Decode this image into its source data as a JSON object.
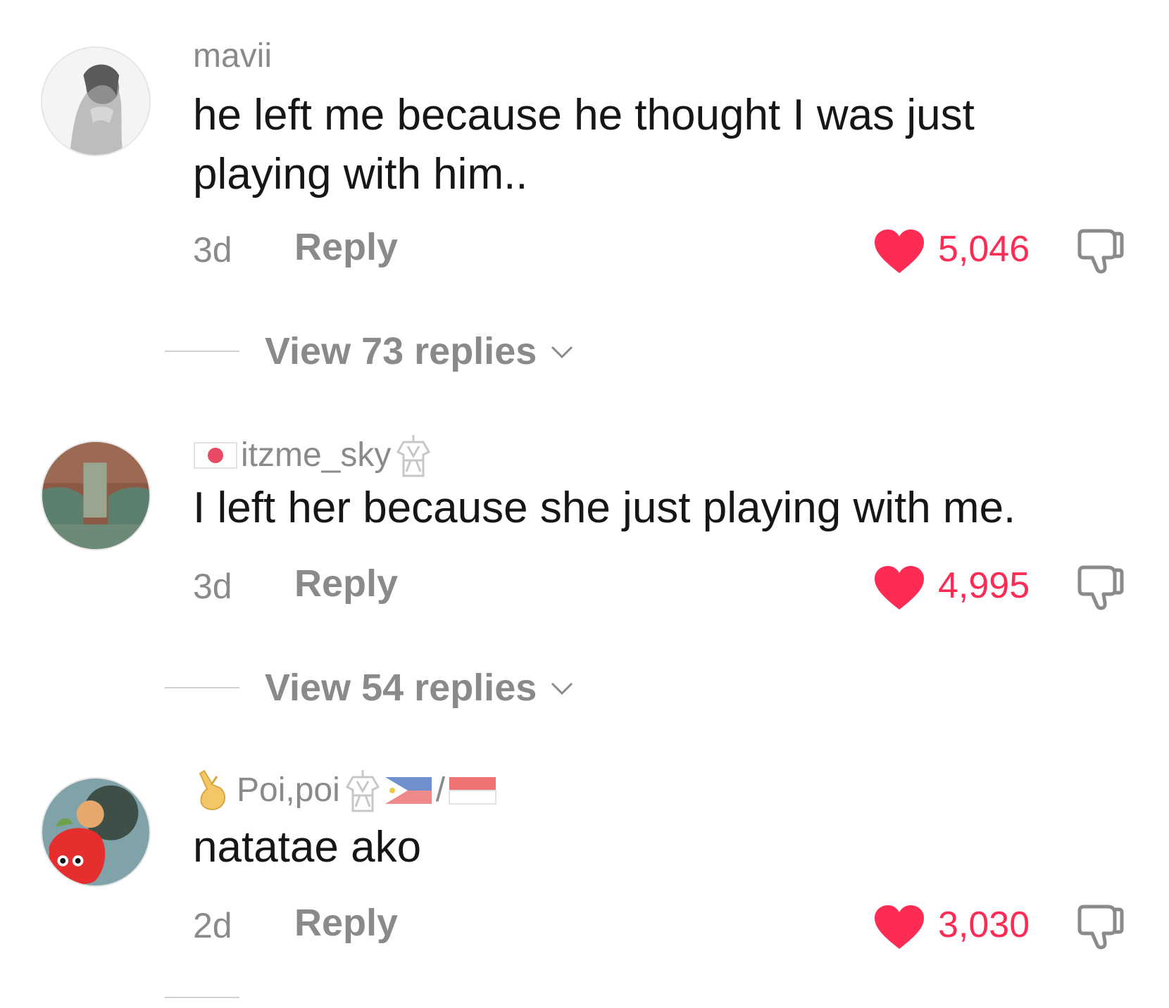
{
  "comments": [
    {
      "username": "mavii",
      "text": "he left me because he thought I was just playing with him..",
      "time": "3d",
      "reply_label": "Reply",
      "likes": "5,046",
      "view_replies": "View 73 replies"
    },
    {
      "username": "itzme_sky",
      "text": "I left her because she just playing with me.",
      "time": "3d",
      "reply_label": "Reply",
      "likes": "4,995",
      "view_replies": "View 54 replies"
    },
    {
      "username": "Poi,poi",
      "username_suffix": "/",
      "text": "natatae ako",
      "time": "2d",
      "reply_label": "Reply",
      "likes": "3,030"
    }
  ],
  "colors": {
    "like": "#fe2c55",
    "muted": "#8a8a8a",
    "text": "#161616"
  },
  "icons": {
    "like": "heart-icon",
    "dislike": "thumbs-down-icon",
    "expand": "chevron-down-icon"
  }
}
